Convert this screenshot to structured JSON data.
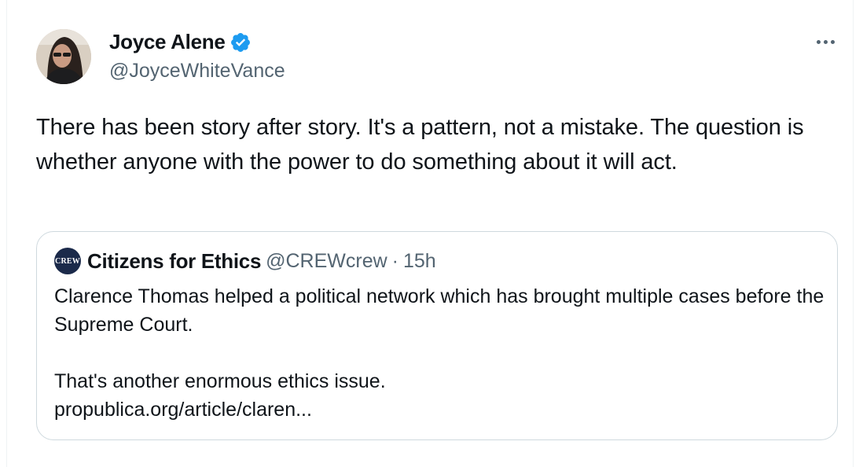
{
  "author": {
    "display_name": "Joyce Alene",
    "handle": "@JoyceWhiteVance",
    "verified": true,
    "avatar": "profile-photo"
  },
  "tweet": {
    "text": "There has been story after story. It's a pattern, not a mistake. The question is whether anyone with the power to do something about it will act."
  },
  "quoted_tweet": {
    "logo_text": "CREW",
    "display_name": "Citizens for Ethics",
    "handle": "@CREWcrew",
    "separator": "·",
    "time": "15h",
    "paragraph_1": "Clarence Thomas helped a political network which has brought multiple cases before the Supreme Court.",
    "paragraph_2": "That's another enormous ethics issue.",
    "link": "propublica.org/article/claren..."
  },
  "icons": {
    "verified": "verified-badge-icon",
    "more": "more-options-icon"
  },
  "colors": {
    "text_primary": "#0f1419",
    "text_secondary": "#536471",
    "verified_blue": "#1d9bf0",
    "border": "#cfd9de",
    "crew_navy": "#1b2a4a"
  }
}
